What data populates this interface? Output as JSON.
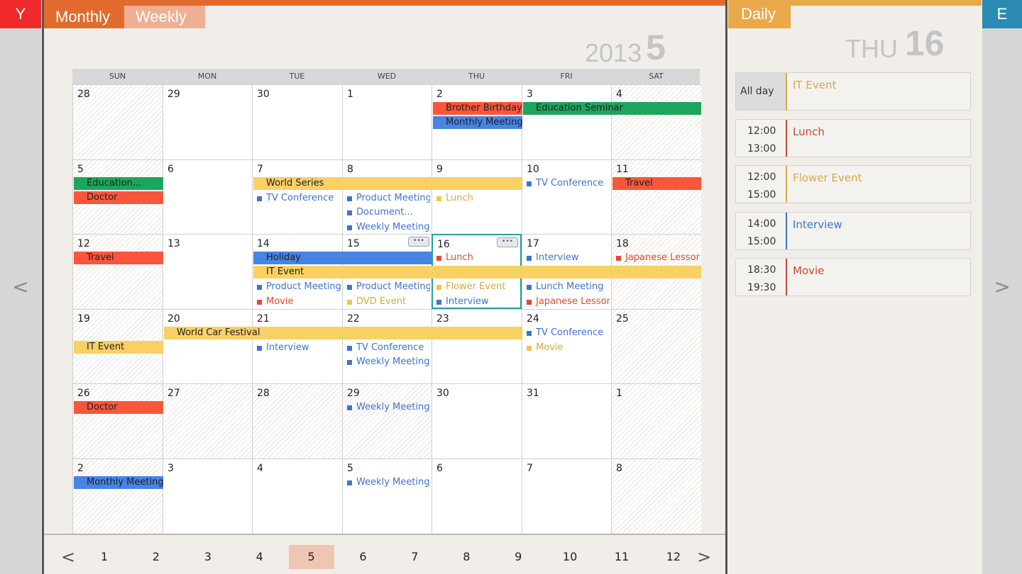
{
  "left_rail": {
    "tab": "Y",
    "arrow": "<"
  },
  "right_rail": {
    "tab": "E",
    "arrow": ">"
  },
  "monthly": {
    "tabs": {
      "monthly": "Monthly",
      "weekly": "Weekly"
    },
    "year": "2013",
    "month": "5",
    "weekdays": [
      "SUN",
      "MON",
      "TUE",
      "WED",
      "THU",
      "FRI",
      "SAT"
    ],
    "weeks": [
      [
        "28",
        "29",
        "30",
        "1",
        "2",
        "3",
        "4"
      ],
      [
        "5",
        "6",
        "7",
        "8",
        "9",
        "10",
        "11"
      ],
      [
        "12",
        "13",
        "14",
        "15",
        "16",
        "17",
        "18"
      ],
      [
        "19",
        "20",
        "21",
        "22",
        "23",
        "24",
        "25"
      ],
      [
        "26",
        "27",
        "28",
        "29",
        "30",
        "31",
        "1"
      ],
      [
        "2",
        "3",
        "4",
        "5",
        "6",
        "7",
        "8"
      ]
    ],
    "shaded_days": [
      [
        0,
        0
      ],
      [
        0,
        6
      ],
      [
        1,
        0
      ],
      [
        1,
        6
      ],
      [
        2,
        0
      ],
      [
        2,
        6
      ],
      [
        3,
        0
      ],
      [
        3,
        6
      ],
      [
        4,
        0
      ],
      [
        4,
        1
      ],
      [
        4,
        2
      ],
      [
        4,
        3
      ],
      [
        4,
        6
      ],
      [
        5,
        0
      ],
      [
        5,
        6
      ]
    ],
    "today": [
      2,
      4
    ],
    "chat_marks": [
      [
        2,
        3
      ],
      [
        2,
        4
      ]
    ],
    "chat_glyph": "•••",
    "bars": [
      {
        "week": 0,
        "start": 4,
        "span": 1,
        "row": 0,
        "color": "red",
        "label": "Brother Birthday"
      },
      {
        "week": 0,
        "start": 5,
        "span": 2,
        "row": 0,
        "color": "green",
        "label": "Education Seminar"
      },
      {
        "week": 0,
        "start": 4,
        "span": 1,
        "row": 1,
        "color": "blue",
        "label": "Monthly Meeting"
      },
      {
        "week": 1,
        "start": 0,
        "span": 1,
        "row": 0,
        "color": "green",
        "label": "Education..."
      },
      {
        "week": 1,
        "start": 0,
        "span": 1,
        "row": 1,
        "color": "red",
        "label": "Doctor"
      },
      {
        "week": 1,
        "start": 2,
        "span": 3,
        "row": 0,
        "color": "yellow",
        "label": "World Series"
      },
      {
        "week": 1,
        "start": 6,
        "span": 1,
        "row": 0,
        "color": "red",
        "label": "Travel"
      },
      {
        "week": 2,
        "start": 0,
        "span": 1,
        "row": 0,
        "color": "red",
        "label": "Travel"
      },
      {
        "week": 2,
        "start": 2,
        "span": 2,
        "row": 0,
        "color": "blue",
        "label": "Holiday"
      },
      {
        "week": 2,
        "start": 2,
        "span": 5,
        "row": 1,
        "color": "yellow",
        "label": "IT Event"
      },
      {
        "week": 3,
        "start": 1,
        "span": 4,
        "row": 0,
        "color": "yellow",
        "label": "World Car Festival"
      },
      {
        "week": 3,
        "start": 0,
        "span": 1,
        "row": 1,
        "color": "yellow",
        "label": "IT Event"
      },
      {
        "week": 4,
        "start": 0,
        "span": 1,
        "row": 0,
        "color": "red",
        "label": "Doctor"
      },
      {
        "week": 5,
        "start": 0,
        "span": 1,
        "row": 0,
        "color": "blue",
        "label": "Monthly Meeting"
      }
    ],
    "items": [
      {
        "week": 1,
        "day": 2,
        "row": 1,
        "color": "blue",
        "label": "TV Conference"
      },
      {
        "week": 1,
        "day": 3,
        "row": 1,
        "color": "blue",
        "label": "Product Meeting"
      },
      {
        "week": 1,
        "day": 3,
        "row": 2,
        "color": "blue",
        "label": "Document..."
      },
      {
        "week": 1,
        "day": 3,
        "row": 3,
        "color": "blue",
        "label": "Weekly Meeting"
      },
      {
        "week": 1,
        "day": 4,
        "row": 1,
        "color": "yellow",
        "label": "Lunch"
      },
      {
        "week": 1,
        "day": 5,
        "row": 0,
        "color": "blue",
        "label": "TV Conference"
      },
      {
        "week": 2,
        "day": 4,
        "row": 0,
        "color": "red",
        "label": "Lunch"
      },
      {
        "week": 2,
        "day": 5,
        "row": 0,
        "color": "blue",
        "label": "Interview"
      },
      {
        "week": 2,
        "day": 6,
        "row": 0,
        "color": "red",
        "label": "Japanese Lesson"
      },
      {
        "week": 2,
        "day": 2,
        "row": 2,
        "color": "blue",
        "label": "Product Meeting"
      },
      {
        "week": 2,
        "day": 3,
        "row": 2,
        "color": "blue",
        "label": "Product Meeting"
      },
      {
        "week": 2,
        "day": 4,
        "row": 2,
        "color": "yellow",
        "label": "Flower Event"
      },
      {
        "week": 2,
        "day": 5,
        "row": 2,
        "color": "blue",
        "label": "Lunch Meeting"
      },
      {
        "week": 2,
        "day": 2,
        "row": 3,
        "color": "red",
        "label": "Movie"
      },
      {
        "week": 2,
        "day": 3,
        "row": 3,
        "color": "yellow",
        "label": "DVD Event"
      },
      {
        "week": 2,
        "day": 4,
        "row": 3,
        "color": "blue",
        "label": "Interview"
      },
      {
        "week": 2,
        "day": 5,
        "row": 3,
        "color": "red",
        "label": "Japanese Lesson"
      },
      {
        "week": 3,
        "day": 5,
        "row": 0,
        "color": "blue",
        "label": "TV Conference"
      },
      {
        "week": 3,
        "day": 2,
        "row": 1,
        "color": "blue",
        "label": "Interview"
      },
      {
        "week": 3,
        "day": 3,
        "row": 1,
        "color": "blue",
        "label": "TV Conference"
      },
      {
        "week": 3,
        "day": 5,
        "row": 1,
        "color": "yellow",
        "label": "Movie"
      },
      {
        "week": 3,
        "day": 3,
        "row": 2,
        "color": "blue",
        "label": "Weekly Meeting"
      },
      {
        "week": 4,
        "day": 3,
        "row": 0,
        "color": "blue",
        "label": "Weekly Meeting"
      },
      {
        "week": 5,
        "day": 3,
        "row": 0,
        "color": "blue",
        "label": "Weekly Meeting"
      }
    ],
    "pager": {
      "prev": "<",
      "next": ">",
      "months": [
        "1",
        "2",
        "3",
        "4",
        "5",
        "6",
        "7",
        "8",
        "9",
        "10",
        "11",
        "12"
      ],
      "active": "5"
    }
  },
  "daily": {
    "tab": "Daily",
    "weekday": "THU",
    "day": "16",
    "events": [
      {
        "start": "All day",
        "end": "",
        "title": "IT Event",
        "color": "#d6aa48",
        "allday": true
      },
      {
        "start": "12:00",
        "end": "13:00",
        "title": "Lunch",
        "color": "#c94a36",
        "allday": false
      },
      {
        "start": "12:00",
        "end": "15:00",
        "title": "Flower Event",
        "color": "#d6aa48",
        "allday": false
      },
      {
        "start": "14:00",
        "end": "15:00",
        "title": "Interview",
        "color": "#3f73cf",
        "allday": false
      },
      {
        "start": "18:30",
        "end": "19:30",
        "title": "Movie",
        "color": "#c94a36",
        "allday": false
      }
    ]
  }
}
